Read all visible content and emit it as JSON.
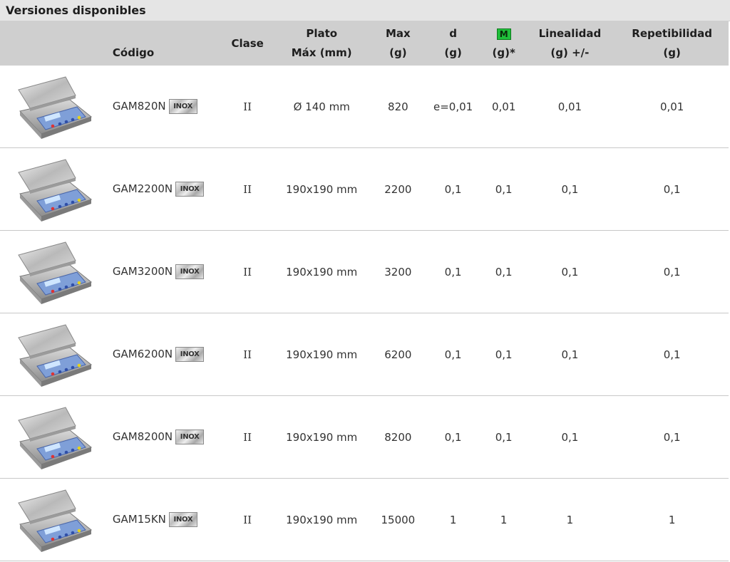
{
  "section_title": "Versiones disponibles",
  "headers": {
    "code": "Código",
    "clase": "Clase",
    "plato_line1": "Plato",
    "plato_line2": "Máx (mm)",
    "max_line1": "Max",
    "max_line2": "(g)",
    "d_line1": "d",
    "d_line2": "(g)",
    "m_badge": "M",
    "m_line2": "(g)*",
    "lin_line1": "Linealidad",
    "lin_line2": "(g) +/-",
    "rep_line1": "Repetibilidad",
    "rep_line2": "(g)"
  },
  "badge_label": "INOX",
  "rows": [
    {
      "code": "GAM820N",
      "clase": "II",
      "plato": "Ø 140 mm",
      "max": "820",
      "d": "e=0,01",
      "m": "0,01",
      "lin": "0,01",
      "rep": "0,01",
      "image_icon": "balance-scale-icon"
    },
    {
      "code": "GAM2200N",
      "clase": "II",
      "plato": "190x190 mm",
      "max": "2200",
      "d": "0,1",
      "m": "0,1",
      "lin": "0,1",
      "rep": "0,1",
      "image_icon": "balance-scale-icon"
    },
    {
      "code": "GAM3200N",
      "clase": "II",
      "plato": "190x190 mm",
      "max": "3200",
      "d": "0,1",
      "m": "0,1",
      "lin": "0,1",
      "rep": "0,1",
      "image_icon": "balance-scale-icon"
    },
    {
      "code": "GAM6200N",
      "clase": "II",
      "plato": "190x190 mm",
      "max": "6200",
      "d": "0,1",
      "m": "0,1",
      "lin": "0,1",
      "rep": "0,1",
      "image_icon": "balance-scale-icon"
    },
    {
      "code": "GAM8200N",
      "clase": "II",
      "plato": "190x190 mm",
      "max": "8200",
      "d": "0,1",
      "m": "0,1",
      "lin": "0,1",
      "rep": "0,1",
      "image_icon": "balance-scale-icon"
    },
    {
      "code": "GAM15KN",
      "clase": "II",
      "plato": "190x190 mm",
      "max": "15000",
      "d": "1",
      "m": "1",
      "lin": "1",
      "rep": "1",
      "image_icon": "balance-scale-icon"
    }
  ],
  "colors": {
    "header_bg": "#cfcfcf",
    "title_bg": "#e5e5e5",
    "m_badge_bg": "#1fbf3a"
  }
}
